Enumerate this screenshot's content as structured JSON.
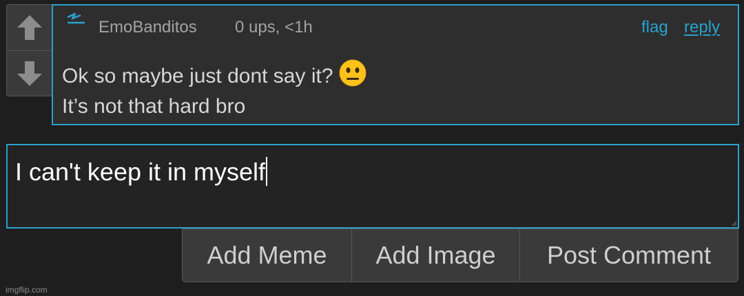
{
  "comment": {
    "username": "EmoBanditos",
    "meta": "0 ups, <1h",
    "flag_label": "flag",
    "reply_label": "reply",
    "lines": [
      "Ok so maybe just dont say it?",
      "It’s not that hard bro"
    ],
    "emoji": "neutral-face-emoji"
  },
  "reply_box": {
    "value": "I can't keep it in myself"
  },
  "buttons": {
    "add_meme": "Add Meme",
    "add_image": "Add Image",
    "post_comment": "Post Comment"
  },
  "watermark": "imgflip.com",
  "icons": {
    "vote_up": "arrow-up-icon",
    "vote_down": "arrow-down-icon",
    "user_badge": "lightning-badge-icon"
  },
  "colors": {
    "accent": "#2aa1cf",
    "background": "#1e1e1f",
    "panel": "#2e2e2f",
    "button": "#3a3a3b"
  }
}
